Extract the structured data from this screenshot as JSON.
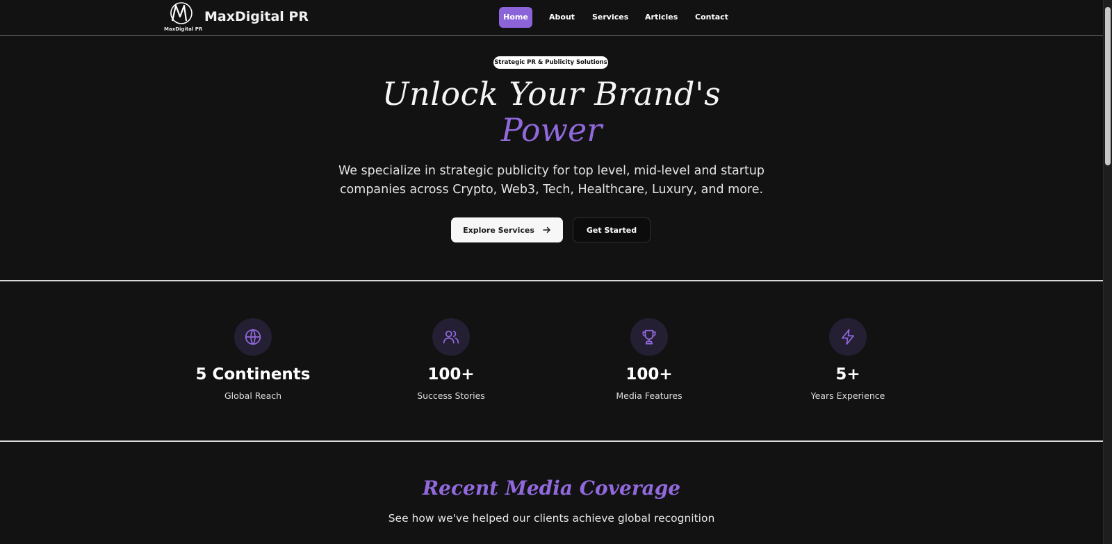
{
  "header": {
    "logo_caption": "MaxDigital PR",
    "brand_name": "MaxDigital PR",
    "nav": [
      {
        "label": "Home",
        "active": true
      },
      {
        "label": "About",
        "active": false
      },
      {
        "label": "Services",
        "active": false
      },
      {
        "label": "Articles",
        "active": false
      },
      {
        "label": "Contact",
        "active": false
      }
    ]
  },
  "hero": {
    "badge": "Strategic PR & Publicity Solutions",
    "title_line1": "Unlock Your Brand's",
    "title_line2": "Power",
    "subtitle": "We specialize in strategic publicity for top level, mid-level and startup companies across Crypto, Web3, Tech, Healthcare, Luxury, and more.",
    "primary_button": "Explore Services",
    "secondary_button": "Get Started"
  },
  "stats": [
    {
      "icon": "globe-icon",
      "value": "5 Continents",
      "label": "Global Reach"
    },
    {
      "icon": "users-icon",
      "value": "100+",
      "label": "Success Stories"
    },
    {
      "icon": "trophy-icon",
      "value": "100+",
      "label": "Media Features"
    },
    {
      "icon": "lightning-icon",
      "value": "5+",
      "label": "Years Experience"
    }
  ],
  "media": {
    "title": "Recent Media Coverage",
    "subtitle": "See how we've helped our clients achieve global recognition"
  },
  "colors": {
    "background": "#121212",
    "accent": "#8b64d9",
    "icon_circle": "#251f33"
  }
}
